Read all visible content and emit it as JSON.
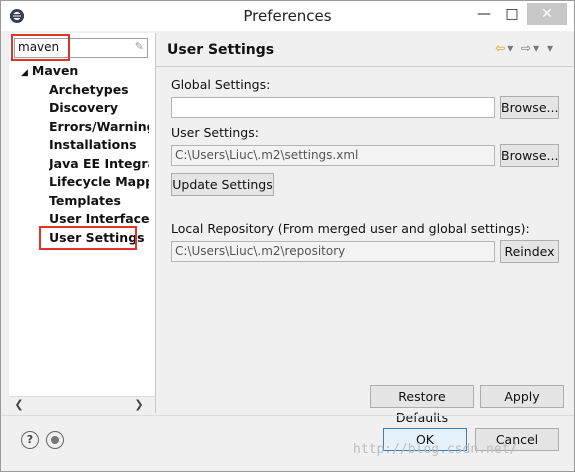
{
  "window": {
    "title": "Preferences",
    "minimize": "—",
    "maximize": "□",
    "close": "✕"
  },
  "sidebar": {
    "filter_value": "maven",
    "root_label": "Maven",
    "items": [
      "Archetypes",
      "Discovery",
      "Errors/Warnings",
      "Installations",
      "Java EE Integrati",
      "Lifecycle Mappir",
      "Templates",
      "User Interface",
      "User Settings"
    ],
    "selected": "User Settings"
  },
  "main": {
    "page_title": "User Settings",
    "global_label": "Global Settings:",
    "global_value": "",
    "user_label": "User Settings:",
    "user_value": "C:\\Users\\Liuc\\.m2\\settings.xml",
    "browse_label": "Browse...",
    "update_label": "Update Settings",
    "local_repo_label": "Local Repository (From merged user and global settings):",
    "local_repo_value": "C:\\Users\\Liuc\\.m2\\repository",
    "reindex_label": "Reindex",
    "restore_defaults_label": "Restore Defaults",
    "apply_label": "Apply"
  },
  "footer": {
    "ok_label": "OK",
    "cancel_label": "Cancel",
    "watermark": "http://blog.csdn.net/"
  },
  "colors": {
    "highlight": "#e0332b",
    "nav_back": "#d9a21a"
  }
}
